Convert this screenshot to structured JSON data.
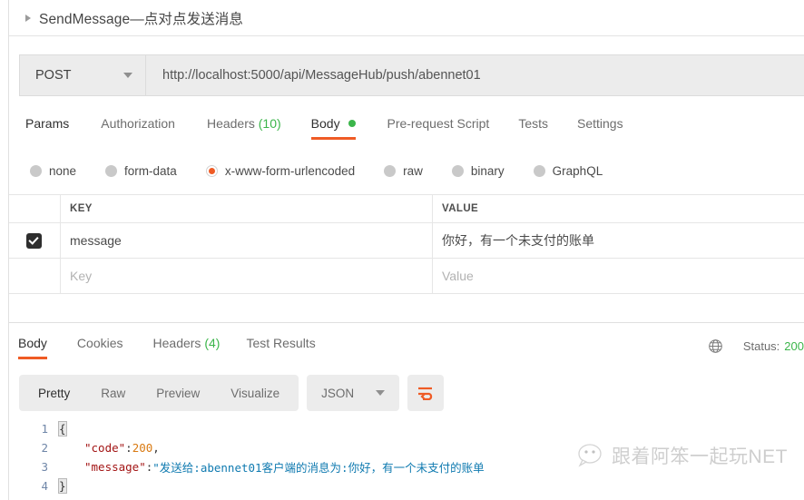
{
  "request": {
    "title": "SendMessage—点对点发送消息",
    "collapse_icon": "triangle-right-icon",
    "method": "POST",
    "method_caret_icon": "chevron-down-icon",
    "url": "http://localhost:5000/api/MessageHub/push/abennet01",
    "tabs": [
      {
        "label": "Params",
        "active": false,
        "count": ""
      },
      {
        "label": "Authorization",
        "active": false,
        "count": ""
      },
      {
        "label": "Headers",
        "active": false,
        "count": "(10)"
      },
      {
        "label": "Body",
        "active": true,
        "count": "",
        "dot": true
      },
      {
        "label": "Pre-request Script",
        "active": false,
        "count": ""
      },
      {
        "label": "Tests",
        "active": false,
        "count": ""
      },
      {
        "label": "Settings",
        "active": false,
        "count": ""
      }
    ],
    "body_types": [
      {
        "label": "none",
        "selected": false
      },
      {
        "label": "form-data",
        "selected": false
      },
      {
        "label": "x-www-form-urlencoded",
        "selected": true
      },
      {
        "label": "raw",
        "selected": false
      },
      {
        "label": "binary",
        "selected": false
      },
      {
        "label": "GraphQL",
        "selected": false
      }
    ],
    "table": {
      "columns": [
        "KEY",
        "VALUE"
      ],
      "rows": [
        {
          "checked": true,
          "key": "message",
          "value": "你好，有一个未支付的账单"
        }
      ],
      "placeholder_key": "Key",
      "placeholder_value": "Value"
    }
  },
  "response": {
    "tabs": [
      {
        "label": "Body",
        "active": true,
        "count": ""
      },
      {
        "label": "Cookies",
        "active": false,
        "count": ""
      },
      {
        "label": "Headers",
        "active": false,
        "count": "(4)"
      },
      {
        "label": "Test Results",
        "active": false,
        "count": ""
      }
    ],
    "globe_icon": "globe-icon",
    "status_label": "Status:",
    "status_code": "200",
    "toolbar": {
      "views": [
        {
          "label": "Pretty",
          "active": true
        },
        {
          "label": "Raw",
          "active": false
        },
        {
          "label": "Preview",
          "active": false
        },
        {
          "label": "Visualize",
          "active": false
        }
      ],
      "format": "JSON",
      "format_caret_icon": "chevron-down-icon",
      "wrap_icon": "word-wrap-icon"
    },
    "body": {
      "lines": [
        {
          "no": "1",
          "open_brace": "{"
        },
        {
          "no": "2",
          "key": "\"code\"",
          "colon": ": ",
          "num": "200",
          "comma": ","
        },
        {
          "no": "3",
          "key": "\"message\"",
          "colon": ": ",
          "str": "\"发送给:abennet01客户端的消息为:你好，有一个未支付的账单"
        },
        {
          "no": "4",
          "close_brace": "}"
        }
      ]
    }
  },
  "watermark": {
    "text": "跟着阿笨一起玩NET",
    "logo_icon": "wechat-bubble-icon"
  },
  "colors": {
    "accent": "#ef5b25",
    "success": "#3bb54a",
    "panel": "#ececec"
  }
}
